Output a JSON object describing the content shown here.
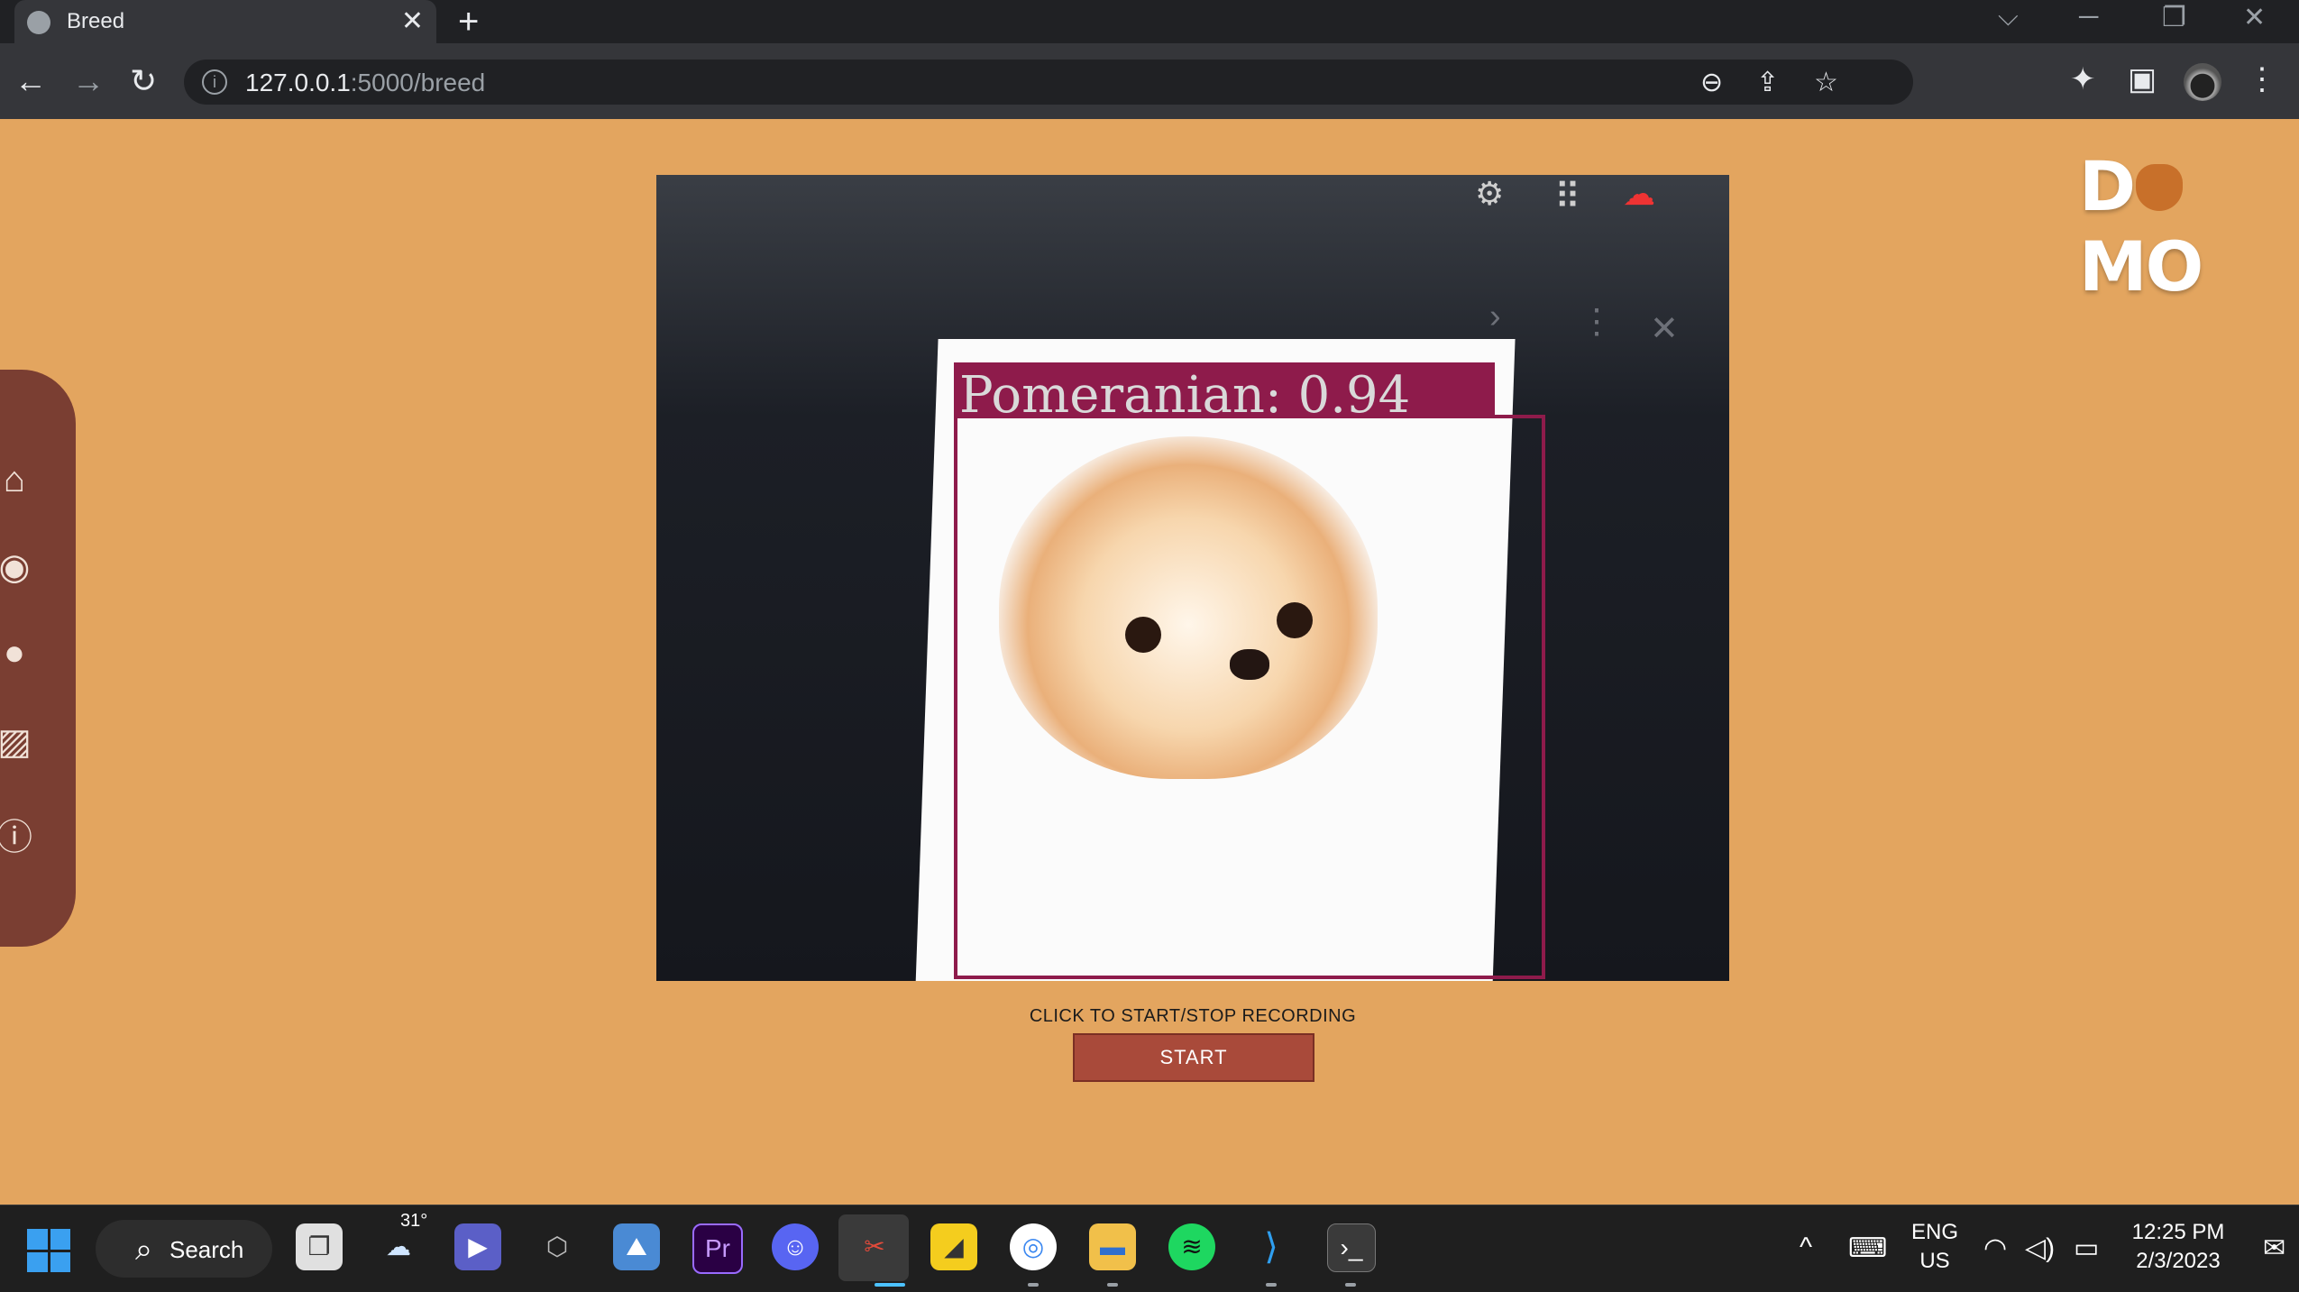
{
  "browser": {
    "tab_title": "Breed",
    "tab_close": "✕",
    "new_tab": "+",
    "url_host": "127.0.0.1",
    "url_path": ":5000/breed",
    "window_controls": [
      "⌵",
      "─",
      "❐",
      "✕"
    ]
  },
  "page": {
    "logo_left": "D",
    "logo_right": "MO",
    "detection_label": "Pomeranian:  0.94",
    "record_instruction": "CLICK TO START/STOP RECORDING",
    "start_button": "START",
    "sidebar_icons": [
      "home-icon",
      "target-icon",
      "record-icon",
      "gallery-icon",
      "info-icon"
    ]
  },
  "taskbar": {
    "search_label": "Search",
    "weather_temp": "31°",
    "language_line1": "ENG",
    "language_line2": "US",
    "time": "12:25 PM",
    "date": "2/3/2023"
  },
  "colors": {
    "page_background": "#e3a55f",
    "sidebar": "#7a3e32",
    "detection_box": "#8e1b4b",
    "start_button": "#a94a3a"
  }
}
